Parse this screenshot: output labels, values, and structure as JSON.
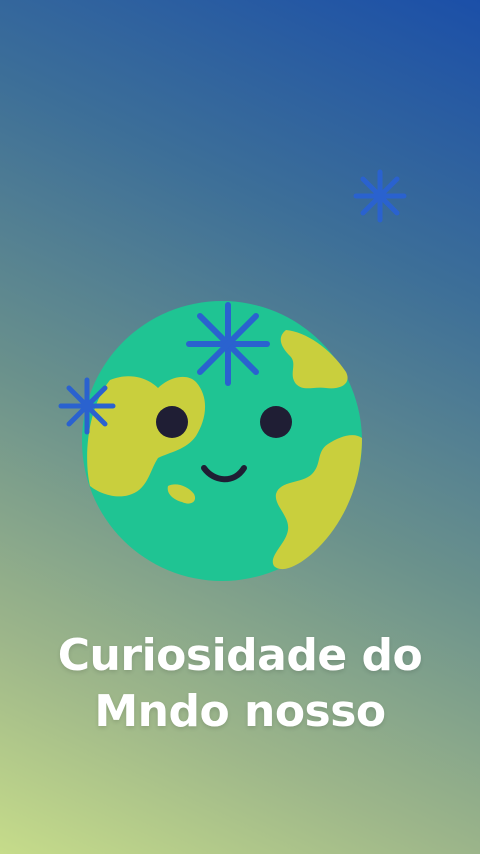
{
  "colors": {
    "globe_ocean": "#1fc493",
    "globe_land": "#c9cf3d",
    "face": "#1f1e34",
    "sparkle": "#2a62cf",
    "title_text": "#ffffff"
  },
  "icons": [
    "globe-icon",
    "sparkle-icon"
  ],
  "title": {
    "line1": "Curiosidade do",
    "line2": "Mndo nosso"
  }
}
